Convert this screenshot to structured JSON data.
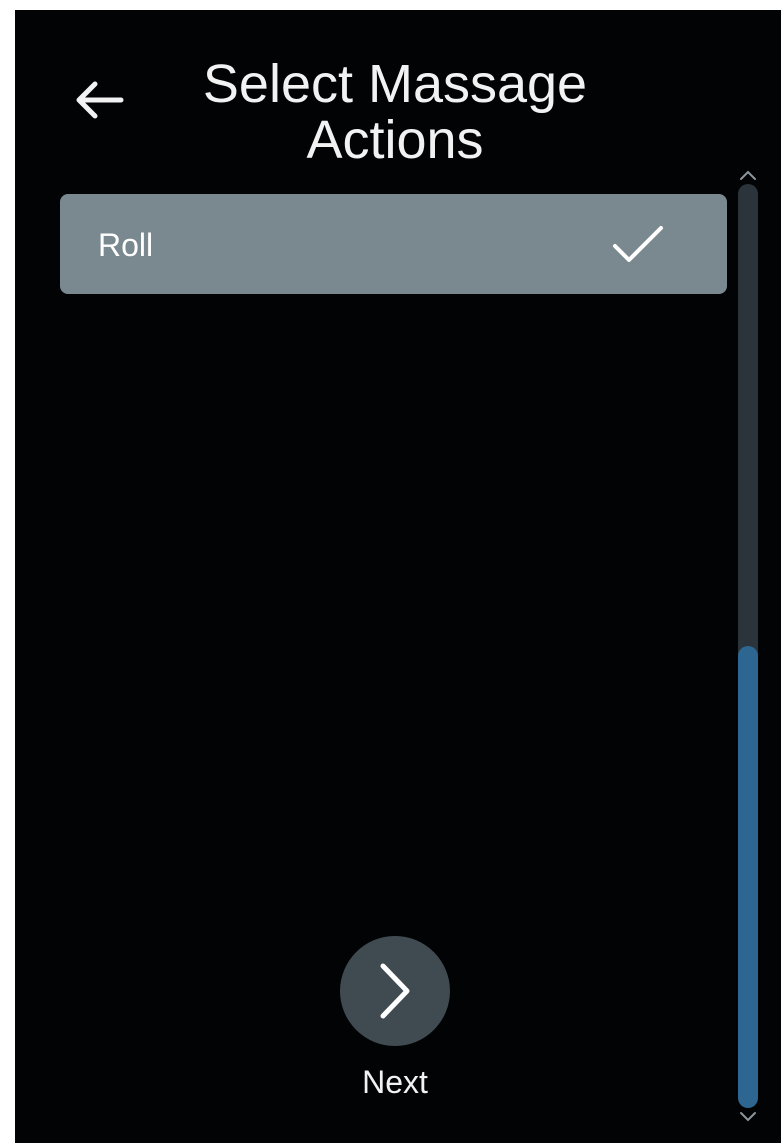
{
  "header": {
    "title": "Select Massage Actions",
    "back_icon": "arrow-left-icon"
  },
  "actions": {
    "items": [
      {
        "label": "Roll",
        "selected": true,
        "check_icon": "checkmark-icon"
      }
    ]
  },
  "scrollbar": {
    "up_icon": "chevron-up-icon",
    "down_icon": "chevron-down-icon",
    "thumb_start": 0.5,
    "thumb_end": 1.0
  },
  "footer": {
    "next_label": "Next",
    "next_icon": "chevron-right-icon"
  },
  "colors": {
    "background": "#020305",
    "selected_item": "#7a8890",
    "scroll_track": "#2b333b",
    "scroll_thumb": "#2d6691",
    "next_button": "#404a51",
    "text": "#f2f2f2"
  }
}
